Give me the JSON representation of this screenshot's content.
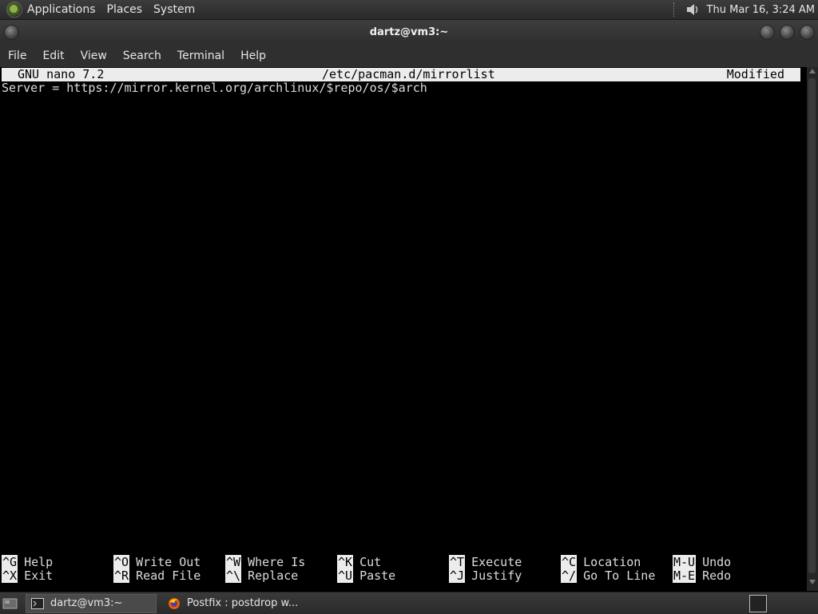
{
  "top_panel": {
    "menus": [
      "Applications",
      "Places",
      "System"
    ],
    "clock": "Thu Mar 16,  3:24 AM"
  },
  "window": {
    "title": "dartz@vm3:~"
  },
  "menubar": {
    "items": [
      "File",
      "Edit",
      "View",
      "Search",
      "Terminal",
      "Help"
    ]
  },
  "nano": {
    "version": "GNU nano 7.2",
    "filename": "/etc/pacman.d/mirrorlist",
    "status": "Modified",
    "line1": "Server = https://mirror.kernel.org/archlinux/$repo/os/$arch",
    "shortcuts_row1": [
      {
        "key": "^G",
        "label": "Help"
      },
      {
        "key": "^O",
        "label": "Write Out"
      },
      {
        "key": "^W",
        "label": "Where Is"
      },
      {
        "key": "^K",
        "label": "Cut"
      },
      {
        "key": "^T",
        "label": "Execute"
      },
      {
        "key": "^C",
        "label": "Location"
      },
      {
        "key": "M-U",
        "label": "Undo"
      }
    ],
    "shortcuts_row2": [
      {
        "key": "^X",
        "label": "Exit"
      },
      {
        "key": "^R",
        "label": "Read File"
      },
      {
        "key": "^\\",
        "label": "Replace"
      },
      {
        "key": "^U",
        "label": "Paste"
      },
      {
        "key": "^J",
        "label": "Justify"
      },
      {
        "key": "^/",
        "label": "Go To Line"
      },
      {
        "key": "M-E",
        "label": "Redo"
      }
    ]
  },
  "taskbar": {
    "items": [
      {
        "label": "dartz@vm3:~",
        "icon": "terminal-icon",
        "active": true
      },
      {
        "label": "Postfix : postdrop w...",
        "icon": "firefox-icon",
        "active": false
      }
    ]
  }
}
